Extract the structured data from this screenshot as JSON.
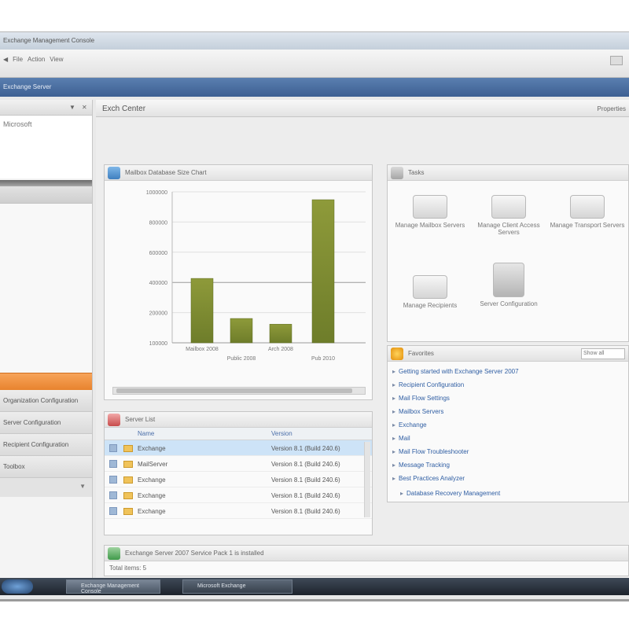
{
  "window": {
    "title": "Exchange Management Console"
  },
  "toolbar": {
    "nav": [
      "File",
      "Action",
      "View"
    ]
  },
  "appbar": {
    "title": "Exchange Server"
  },
  "left_panel": {
    "header": "",
    "tree_item": "Microsoft",
    "items": [
      "Organization Configuration",
      "Server Configuration",
      "Recipient Configuration",
      "Toolbox"
    ]
  },
  "content": {
    "title": "Exch Center",
    "right_label": "Properties"
  },
  "chart_panel": {
    "title": "Mailbox Database Size Chart"
  },
  "chart_data": {
    "type": "bar",
    "categories": [
      "Mailbox 2008",
      "Public 2008",
      "Arch 2008",
      "Pub 2010"
    ],
    "values": [
      45,
      17,
      13,
      100
    ],
    "ylim": [
      0,
      100
    ],
    "yticks": [
      "1000000",
      "800000",
      "600000",
      "400000",
      "200000",
      "100000"
    ],
    "color": "#6e7d2a"
  },
  "grid_panel": {
    "title": "Server List",
    "columns": [
      "Name",
      "Version"
    ],
    "rows": [
      {
        "name": "Exchange",
        "version": "Version 8.1 (Build 240.6)"
      },
      {
        "name": "MailServer",
        "version": "Version 8.1 (Build 240.6)"
      },
      {
        "name": "Exchange",
        "version": "Version 8.1 (Build 240.6)"
      },
      {
        "name": "Exchange",
        "version": "Version 8.1 (Build 240.6)"
      },
      {
        "name": "Exchange",
        "version": "Version 8.1 (Build 240.6)"
      }
    ]
  },
  "status_panel": {
    "title": "Exchange Server 2007 Service Pack 1 is installed",
    "subtitle": "Total items: 5"
  },
  "tasks_panel": {
    "title": "Tasks",
    "tasks": [
      "Manage Mailbox Servers",
      "Manage Client Access Servers",
      "Manage Transport Servers",
      "Manage Recipients",
      "Server Configuration"
    ]
  },
  "links_panel": {
    "title": "Favorites",
    "dropdown": "Show all",
    "links": [
      "Getting started with Exchange Server 2007",
      "Recipient Configuration",
      "Mail Flow Settings",
      "Mailbox Servers",
      "Exchange",
      "Mail",
      "Mail Flow Troubleshooter",
      "Message Tracking",
      "Best Practices Analyzer",
      "Database Recovery Management"
    ]
  },
  "taskbar": {
    "buttons": [
      "Exchange Management Console",
      "Microsoft Exchange"
    ]
  },
  "colors": {
    "accent": "#3d5f92",
    "highlight": "#e8832e",
    "bar": "#6e7d2a",
    "link": "#2f5ea3"
  }
}
